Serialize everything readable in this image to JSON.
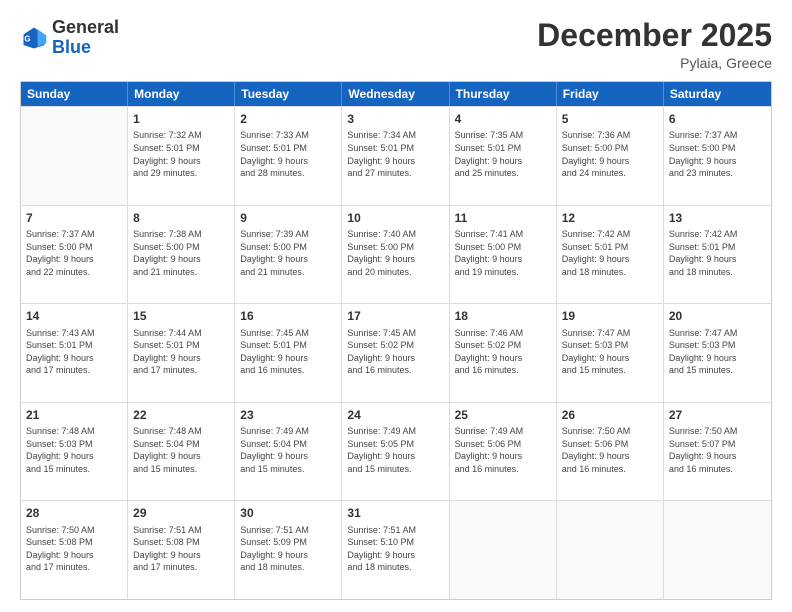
{
  "header": {
    "logo_line1": "General",
    "logo_line2": "Blue",
    "month_year": "December 2025",
    "location": "Pylaia, Greece"
  },
  "days_of_week": [
    "Sunday",
    "Monday",
    "Tuesday",
    "Wednesday",
    "Thursday",
    "Friday",
    "Saturday"
  ],
  "weeks": [
    [
      {
        "day": "",
        "info": ""
      },
      {
        "day": "1",
        "info": "Sunrise: 7:32 AM\nSunset: 5:01 PM\nDaylight: 9 hours\nand 29 minutes."
      },
      {
        "day": "2",
        "info": "Sunrise: 7:33 AM\nSunset: 5:01 PM\nDaylight: 9 hours\nand 28 minutes."
      },
      {
        "day": "3",
        "info": "Sunrise: 7:34 AM\nSunset: 5:01 PM\nDaylight: 9 hours\nand 27 minutes."
      },
      {
        "day": "4",
        "info": "Sunrise: 7:35 AM\nSunset: 5:01 PM\nDaylight: 9 hours\nand 25 minutes."
      },
      {
        "day": "5",
        "info": "Sunrise: 7:36 AM\nSunset: 5:00 PM\nDaylight: 9 hours\nand 24 minutes."
      },
      {
        "day": "6",
        "info": "Sunrise: 7:37 AM\nSunset: 5:00 PM\nDaylight: 9 hours\nand 23 minutes."
      }
    ],
    [
      {
        "day": "7",
        "info": "Sunrise: 7:37 AM\nSunset: 5:00 PM\nDaylight: 9 hours\nand 22 minutes."
      },
      {
        "day": "8",
        "info": "Sunrise: 7:38 AM\nSunset: 5:00 PM\nDaylight: 9 hours\nand 21 minutes."
      },
      {
        "day": "9",
        "info": "Sunrise: 7:39 AM\nSunset: 5:00 PM\nDaylight: 9 hours\nand 21 minutes."
      },
      {
        "day": "10",
        "info": "Sunrise: 7:40 AM\nSunset: 5:00 PM\nDaylight: 9 hours\nand 20 minutes."
      },
      {
        "day": "11",
        "info": "Sunrise: 7:41 AM\nSunset: 5:00 PM\nDaylight: 9 hours\nand 19 minutes."
      },
      {
        "day": "12",
        "info": "Sunrise: 7:42 AM\nSunset: 5:01 PM\nDaylight: 9 hours\nand 18 minutes."
      },
      {
        "day": "13",
        "info": "Sunrise: 7:42 AM\nSunset: 5:01 PM\nDaylight: 9 hours\nand 18 minutes."
      }
    ],
    [
      {
        "day": "14",
        "info": "Sunrise: 7:43 AM\nSunset: 5:01 PM\nDaylight: 9 hours\nand 17 minutes."
      },
      {
        "day": "15",
        "info": "Sunrise: 7:44 AM\nSunset: 5:01 PM\nDaylight: 9 hours\nand 17 minutes."
      },
      {
        "day": "16",
        "info": "Sunrise: 7:45 AM\nSunset: 5:01 PM\nDaylight: 9 hours\nand 16 minutes."
      },
      {
        "day": "17",
        "info": "Sunrise: 7:45 AM\nSunset: 5:02 PM\nDaylight: 9 hours\nand 16 minutes."
      },
      {
        "day": "18",
        "info": "Sunrise: 7:46 AM\nSunset: 5:02 PM\nDaylight: 9 hours\nand 16 minutes."
      },
      {
        "day": "19",
        "info": "Sunrise: 7:47 AM\nSunset: 5:03 PM\nDaylight: 9 hours\nand 15 minutes."
      },
      {
        "day": "20",
        "info": "Sunrise: 7:47 AM\nSunset: 5:03 PM\nDaylight: 9 hours\nand 15 minutes."
      }
    ],
    [
      {
        "day": "21",
        "info": "Sunrise: 7:48 AM\nSunset: 5:03 PM\nDaylight: 9 hours\nand 15 minutes."
      },
      {
        "day": "22",
        "info": "Sunrise: 7:48 AM\nSunset: 5:04 PM\nDaylight: 9 hours\nand 15 minutes."
      },
      {
        "day": "23",
        "info": "Sunrise: 7:49 AM\nSunset: 5:04 PM\nDaylight: 9 hours\nand 15 minutes."
      },
      {
        "day": "24",
        "info": "Sunrise: 7:49 AM\nSunset: 5:05 PM\nDaylight: 9 hours\nand 15 minutes."
      },
      {
        "day": "25",
        "info": "Sunrise: 7:49 AM\nSunset: 5:06 PM\nDaylight: 9 hours\nand 16 minutes."
      },
      {
        "day": "26",
        "info": "Sunrise: 7:50 AM\nSunset: 5:06 PM\nDaylight: 9 hours\nand 16 minutes."
      },
      {
        "day": "27",
        "info": "Sunrise: 7:50 AM\nSunset: 5:07 PM\nDaylight: 9 hours\nand 16 minutes."
      }
    ],
    [
      {
        "day": "28",
        "info": "Sunrise: 7:50 AM\nSunset: 5:08 PM\nDaylight: 9 hours\nand 17 minutes."
      },
      {
        "day": "29",
        "info": "Sunrise: 7:51 AM\nSunset: 5:08 PM\nDaylight: 9 hours\nand 17 minutes."
      },
      {
        "day": "30",
        "info": "Sunrise: 7:51 AM\nSunset: 5:09 PM\nDaylight: 9 hours\nand 18 minutes."
      },
      {
        "day": "31",
        "info": "Sunrise: 7:51 AM\nSunset: 5:10 PM\nDaylight: 9 hours\nand 18 minutes."
      },
      {
        "day": "",
        "info": ""
      },
      {
        "day": "",
        "info": ""
      },
      {
        "day": "",
        "info": ""
      }
    ]
  ]
}
